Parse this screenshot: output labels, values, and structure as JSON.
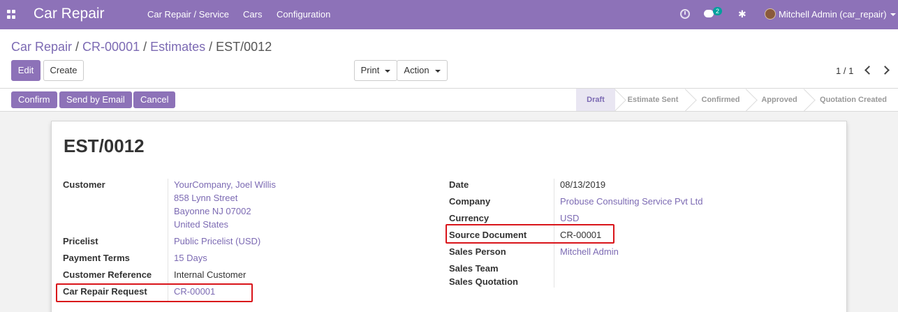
{
  "app": {
    "title": "Car Repair",
    "menu": [
      "Car Repair / Service",
      "Cars",
      "Configuration"
    ],
    "chat_count": "2",
    "user": "Mitchell Admin (car_repair)"
  },
  "breadcrumb": {
    "items": [
      "Car Repair",
      "CR-00001",
      "Estimates"
    ],
    "current": "EST/0012",
    "separator": "/"
  },
  "toolbar": {
    "edit_label": "Edit",
    "create_label": "Create",
    "print_label": "Print",
    "action_label": "Action"
  },
  "pager": {
    "value": "1 / 1"
  },
  "statusbar": {
    "buttons": [
      "Confirm",
      "Send by Email",
      "Cancel"
    ],
    "stages": [
      "Draft",
      "Estimate Sent",
      "Confirmed",
      "Approved",
      "Quotation Created"
    ],
    "active_stage": "Draft"
  },
  "record": {
    "title": "EST/0012",
    "left_fields": {
      "customer_label": "Customer",
      "customer_lines": [
        "YourCompany, Joel Willis",
        "858 Lynn Street",
        "Bayonne NJ 07002",
        "United States"
      ],
      "pricelist_label": "Pricelist",
      "pricelist_value": "Public Pricelist (USD)",
      "payment_terms_label": "Payment Terms",
      "payment_terms_value": "15 Days",
      "customer_ref_label": "Customer Reference",
      "customer_ref_value": "Internal Customer",
      "car_repair_request_label": "Car Repair Request",
      "car_repair_request_value": "CR-00001"
    },
    "right_fields": {
      "date_label": "Date",
      "date_value": "08/13/2019",
      "company_label": "Company",
      "company_value": "Probuse Consulting Service Pvt Ltd",
      "currency_label": "Currency",
      "currency_value": "USD",
      "source_document_label": "Source Document",
      "source_document_value": "CR-00001",
      "sales_person_label": "Sales Person",
      "sales_person_value": "Mitchell Admin",
      "sales_team_label": "Sales Team",
      "sales_quotation_label": "Sales Quotation"
    }
  },
  "colors": {
    "brand": "#8d72b8",
    "link": "#7c6ab3",
    "highlight": "#d9141a"
  }
}
